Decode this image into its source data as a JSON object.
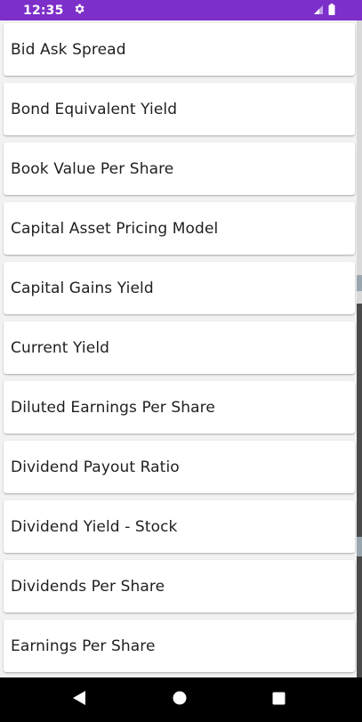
{
  "status_bar": {
    "time": "12:35",
    "background": "#7d2fc9",
    "icons": [
      "gear-icon",
      "signal-icon",
      "battery-icon"
    ]
  },
  "list": {
    "items": [
      {
        "label": "Bid Ask Spread"
      },
      {
        "label": "Bond Equivalent Yield"
      },
      {
        "label": "Book Value Per Share"
      },
      {
        "label": "Capital Asset Pricing Model"
      },
      {
        "label": "Capital Gains Yield"
      },
      {
        "label": "Current Yield"
      },
      {
        "label": "Diluted Earnings Per Share"
      },
      {
        "label": "Dividend Payout Ratio"
      },
      {
        "label": "Dividend Yield - Stock"
      },
      {
        "label": "Dividends Per Share"
      },
      {
        "label": "Earnings Per Share"
      }
    ]
  },
  "nav_bar": {
    "buttons": [
      "back-icon",
      "home-icon",
      "recents-icon"
    ]
  }
}
